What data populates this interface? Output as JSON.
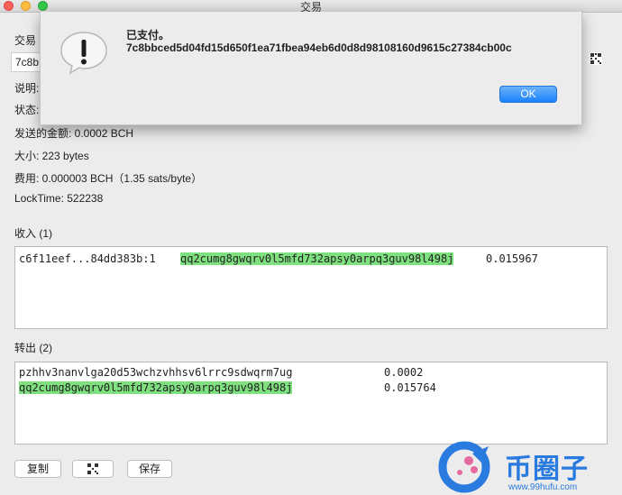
{
  "window": {
    "title": "交易"
  },
  "details": {
    "tx_label": "交易",
    "txid_partial": "7c8b",
    "desc_label": "说明:",
    "status_label": "状态:",
    "amount": "发送的金额: 0.0002 BCH",
    "size": "大小:   223 bytes",
    "fee": "费用: 0.000003 BCH（1.35 sats/byte）",
    "locktime": "LockTime: 522238"
  },
  "inputs": {
    "header": "收入 (1)",
    "rows": [
      {
        "prevout": "c6f11eef...84dd383b:1",
        "address": "qq2cumg8gwqrv0l5mfd732apsy0arpq3guv98l498j",
        "amount": "0.015967"
      }
    ]
  },
  "outputs": {
    "header": "转出 (2)",
    "rows": [
      {
        "address": "pzhhv3nanvlga20d53wchzvhhsv6lrrc9sdwqrm7ug",
        "amount": "0.0002"
      },
      {
        "address": "qq2cumg8gwqrv0l5mfd732apsy0arpq3guv98l498j",
        "amount": "0.015764"
      }
    ]
  },
  "buttons": {
    "copy": "复制",
    "save": "保存"
  },
  "dialog": {
    "title": "已支付。",
    "message": "7c8bbced5d04fd15d650f1ea71fbea94eb6d0d8d98108160d9615c27384cb00c",
    "ok": "OK"
  },
  "watermark": {
    "brand": "币圈子",
    "url": "www.99hufu.com"
  },
  "colors": {
    "highlight": "#7fe07f",
    "accent": "#1a82fb",
    "brand": "#2a7be0"
  }
}
